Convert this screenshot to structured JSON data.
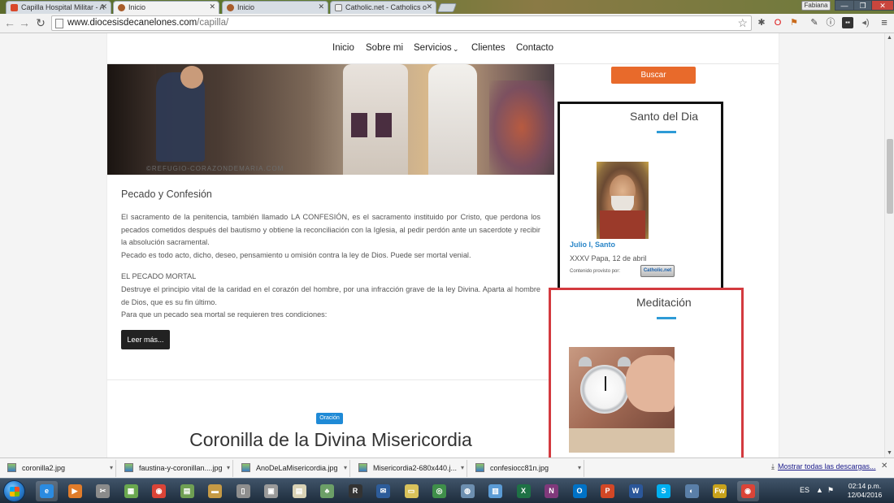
{
  "browser": {
    "tabs": [
      {
        "title": "Capilla Hospital Militar - A",
        "active": false,
        "favicon_color": "#d9482b"
      },
      {
        "title": "Inicio",
        "active": true,
        "favicon_color": "#a85c2b"
      },
      {
        "title": "Inicio",
        "active": false,
        "favicon_color": "#a85c2b"
      },
      {
        "title": "Catholic.net - Catholics o",
        "active": false,
        "favicon_color": "#eeeeee"
      }
    ],
    "user_label": "Fabiana",
    "url_host": "www.diocesisdecanelones.com",
    "url_path": "/capilla/"
  },
  "site": {
    "nav": {
      "items": [
        "Inicio",
        "Sobre mi",
        "Servicios",
        "Clientes",
        "Contacto"
      ],
      "dropdown_icon": "chevron-down-icon"
    },
    "hero": {
      "watermark": "©REFUGIO-CORAZONDEMARIA.COM"
    },
    "article": {
      "title": "Pecado y Confesión",
      "paragraphs": [
        "El sacramento de la penitencia, también llamado LA CONFESIÓN, es el sacramento instituido por Cristo, que perdona los pecados cometidos después del bautismo y obtiene la reconciliación con la Iglesia, al pedir perdón ante un sacerdote y recibir la absolución sacramental.",
        "Pecado es todo acto, dicho, deseo, pensamiento u omisión contra la ley de Dios. Puede ser mortal venial.",
        "EL PECADO MORTAL",
        "Destruye el principio vital de la caridad en el corazón del hombre, por una infracción grave de la ley Divina. Aparta al hombre de Dios, que es su fin último.",
        "Para que un pecado sea mortal se requieren tres condiciones:"
      ],
      "read_more": "Leer más..."
    },
    "next_post": {
      "category": "Oración",
      "title": "Coronilla de la Divina Misericordia"
    },
    "sidebar": {
      "search_button": "Buscar",
      "saint_widget": {
        "heading": "Santo del Dia",
        "name": "Julio I, Santo",
        "subtitle": "XXXV Papa, 12 de abril",
        "provided_by": "Contenido provisto por:",
        "logo_text": "Catholic.net"
      },
      "meditation_widget": {
        "heading": "Meditación"
      }
    },
    "colors": {
      "accent_blue": "#2e9bd6",
      "search_orange": "#e86a2b",
      "saint_border": "#111111",
      "meditation_border": "#d33a3f"
    }
  },
  "downloads": {
    "items": [
      "coronilla2.jpg",
      "faustina-y-coronillan....jpg",
      "AnoDeLaMisericordia.jpg",
      "Misericordia2-680x440.j...",
      "confesiocc81n.jpg"
    ],
    "show_all": "Mostrar todas las descargas...",
    "show_all_icon": "download-icon"
  },
  "taskbar": {
    "apps": [
      {
        "name": "ie",
        "glyph": "e",
        "color": "#2b8be0"
      },
      {
        "name": "media-player",
        "glyph": "▶",
        "color": "#e17c2a"
      },
      {
        "name": "snipping",
        "glyph": "✂",
        "color": "#8b8b8b"
      },
      {
        "name": "store",
        "glyph": "▦",
        "color": "#6aa84f"
      },
      {
        "name": "chrome",
        "glyph": "◉",
        "color": "#db4437"
      },
      {
        "name": "calc",
        "glyph": "▤",
        "color": "#6f9f53"
      },
      {
        "name": "bible",
        "glyph": "▬",
        "color": "#c69a45"
      },
      {
        "name": "phone",
        "glyph": "▯",
        "color": "#8e8e8e"
      },
      {
        "name": "tools",
        "glyph": "▣",
        "color": "#9a9a9a"
      },
      {
        "name": "notes",
        "glyph": "▤",
        "color": "#d9d2b5"
      },
      {
        "name": "network",
        "glyph": "♣",
        "color": "#6c9f67"
      },
      {
        "name": "rdp",
        "glyph": "R",
        "color": "#333333"
      },
      {
        "name": "mail-app",
        "glyph": "✉",
        "color": "#2d5c9a"
      },
      {
        "name": "folder",
        "glyph": "▭",
        "color": "#d9c25b"
      },
      {
        "name": "eye",
        "glyph": "◎",
        "color": "#3f8f4a"
      },
      {
        "name": "people",
        "glyph": "◍",
        "color": "#6d8fb0"
      },
      {
        "name": "maps",
        "glyph": "▥",
        "color": "#5b9bd5"
      },
      {
        "name": "excel",
        "glyph": "X",
        "color": "#1e7145"
      },
      {
        "name": "onenote",
        "glyph": "N",
        "color": "#80397b"
      },
      {
        "name": "outlook",
        "glyph": "O",
        "color": "#0072c6"
      },
      {
        "name": "powerpoint",
        "glyph": "P",
        "color": "#d24726"
      },
      {
        "name": "word",
        "glyph": "W",
        "color": "#2b579a"
      },
      {
        "name": "skype",
        "glyph": "S",
        "color": "#00aff0"
      },
      {
        "name": "globe",
        "glyph": "◐",
        "color": "#5a7fa8"
      },
      {
        "name": "fireworks",
        "glyph": "Fw",
        "color": "#c8a21b"
      },
      {
        "name": "chrome-active",
        "glyph": "◉",
        "color": "#db4437"
      }
    ],
    "language": "ES",
    "time": "02:14 p.m.",
    "date": "12/04/2016"
  }
}
